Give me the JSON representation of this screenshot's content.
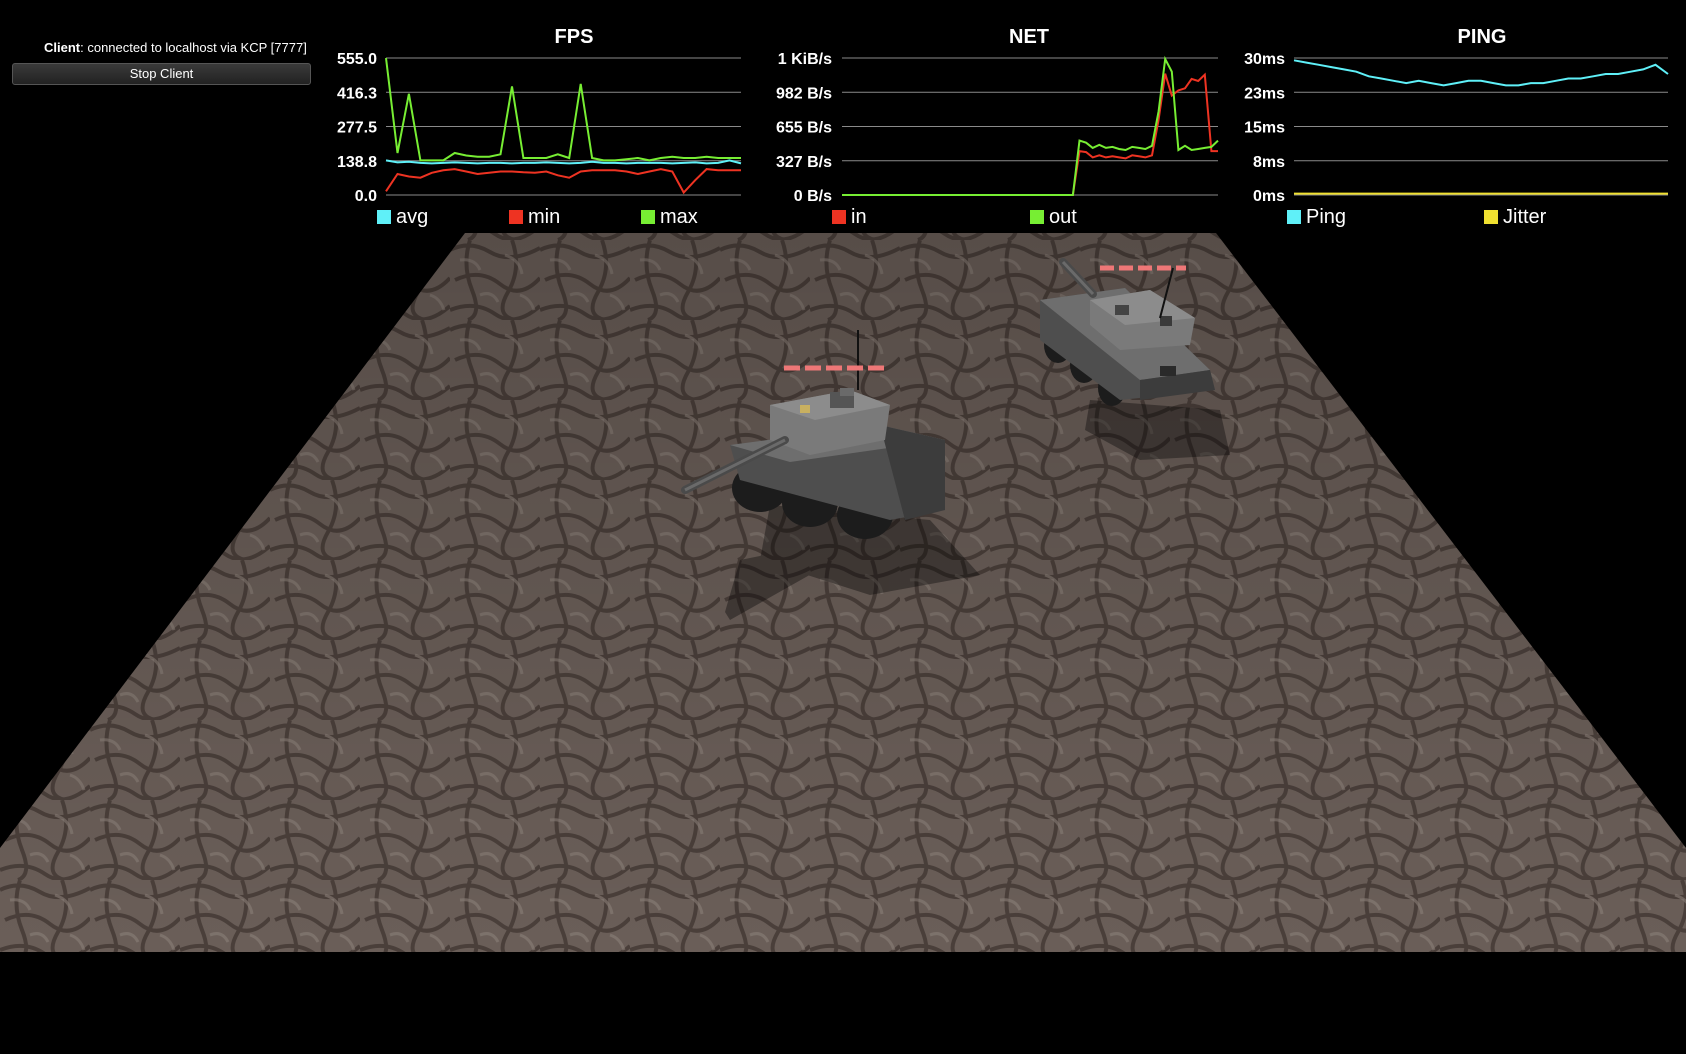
{
  "client_status": {
    "label": "Client",
    "text": ": connected to localhost via KCP [7777]"
  },
  "stop_button": {
    "label": "Stop Client"
  },
  "colors": {
    "avg": "#5ff0f8",
    "min": "#ee3322",
    "max": "#77ee33",
    "in": "#ee3322",
    "out": "#77ee33",
    "ping": "#5ff0f8",
    "jitter": "#f0e030",
    "health_bar": "#ee7777"
  },
  "graphs": [
    {
      "id": "fps",
      "title": "FPS",
      "ticks": [
        "555.0",
        "416.3",
        "277.5",
        "138.8",
        "0.0"
      ],
      "ymax": 555,
      "legend": [
        {
          "name": "avg",
          "color_key": "avg"
        },
        {
          "name": "min",
          "color_key": "min"
        },
        {
          "name": "max",
          "color_key": "max"
        }
      ]
    },
    {
      "id": "net",
      "title": "NET",
      "ticks": [
        "1 KiB/s",
        "982 B/s",
        "655 B/s",
        "327 B/s",
        "0 B/s"
      ],
      "ymax": 1310,
      "legend": [
        {
          "name": "in",
          "color_key": "in"
        },
        {
          "name": "out",
          "color_key": "out"
        }
      ]
    },
    {
      "id": "ping",
      "title": "PING",
      "ticks": [
        "30ms",
        "23ms",
        "15ms",
        "8ms",
        "0ms"
      ],
      "ymax": 30,
      "legend": [
        {
          "name": "Ping",
          "color_key": "ping"
        },
        {
          "name": "Jitter",
          "color_key": "jitter"
        }
      ]
    }
  ],
  "chart_data": [
    {
      "type": "line",
      "title": "FPS",
      "ylim": [
        0,
        555
      ],
      "series": [
        {
          "name": "avg",
          "values": [
            140,
            132,
            135,
            130,
            128,
            130,
            132,
            130,
            128,
            130,
            130,
            128,
            130,
            130,
            132,
            130,
            128,
            130,
            135,
            130,
            130,
            128,
            130,
            130,
            130,
            128,
            130,
            132,
            128,
            130,
            140,
            128
          ]
        },
        {
          "name": "min",
          "values": [
            15,
            85,
            75,
            70,
            90,
            100,
            105,
            95,
            85,
            90,
            95,
            95,
            92,
            90,
            95,
            80,
            70,
            95,
            100,
            100,
            100,
            95,
            85,
            95,
            105,
            95,
            10,
            60,
            105,
            100,
            100,
            100
          ]
        },
        {
          "name": "max",
          "values": [
            555,
            170,
            410,
            140,
            140,
            140,
            170,
            160,
            155,
            155,
            165,
            440,
            150,
            150,
            150,
            165,
            150,
            450,
            150,
            140,
            140,
            145,
            150,
            140,
            150,
            155,
            150,
            150,
            155,
            150,
            150,
            150
          ]
        }
      ]
    },
    {
      "type": "line",
      "title": "NET",
      "ylim": [
        0,
        1310
      ],
      "series": [
        {
          "name": "in",
          "values": [
            0,
            0,
            0,
            0,
            0,
            0,
            0,
            0,
            0,
            0,
            0,
            0,
            0,
            0,
            0,
            0,
            0,
            0,
            0,
            0,
            0,
            0,
            0,
            0,
            0,
            0,
            0,
            0,
            0,
            0,
            0,
            0,
            0,
            0,
            0,
            0,
            420,
            410,
            360,
            380,
            360,
            370,
            360,
            350,
            380,
            370,
            360,
            380,
            720,
            1160,
            950,
            1000,
            1020,
            1110,
            1090,
            1150,
            420,
            420
          ]
        },
        {
          "name": "out",
          "values": [
            0,
            0,
            0,
            0,
            0,
            0,
            0,
            0,
            0,
            0,
            0,
            0,
            0,
            0,
            0,
            0,
            0,
            0,
            0,
            0,
            0,
            0,
            0,
            0,
            0,
            0,
            0,
            0,
            0,
            0,
            0,
            0,
            0,
            0,
            0,
            0,
            520,
            500,
            450,
            480,
            450,
            460,
            440,
            430,
            460,
            450,
            440,
            470,
            800,
            1300,
            1180,
            430,
            470,
            430,
            440,
            450,
            460,
            520
          ]
        }
      ]
    },
    {
      "type": "line",
      "title": "PING",
      "ylim": [
        0,
        30
      ],
      "series": [
        {
          "name": "Ping",
          "values": [
            29.5,
            29,
            28.5,
            28,
            27.5,
            27,
            26,
            25.5,
            25,
            24.5,
            25,
            24.5,
            24,
            24.5,
            25,
            25,
            24.5,
            24,
            24,
            24.5,
            24.5,
            25,
            25.5,
            25.5,
            26,
            26.5,
            26.5,
            27,
            27.5,
            28.5,
            26.5
          ]
        },
        {
          "name": "Jitter",
          "values": [
            0.3,
            0.3,
            0.3,
            0.3,
            0.3,
            0.3,
            0.3,
            0.3,
            0.3,
            0.3,
            0.3,
            0.3,
            0.3,
            0.3,
            0.3,
            0.3,
            0.3,
            0.3,
            0.3,
            0.3,
            0.3,
            0.3,
            0.3,
            0.3,
            0.3,
            0.3,
            0.3,
            0.3,
            0.3,
            0.3,
            0.3
          ]
        }
      ]
    }
  ]
}
